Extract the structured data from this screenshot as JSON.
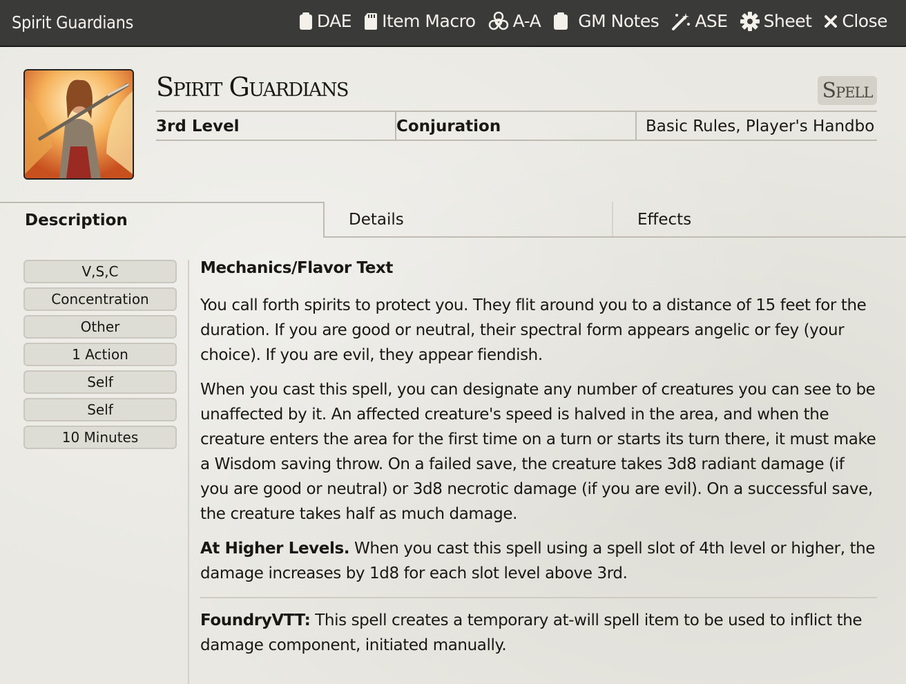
{
  "window": {
    "title": "Spirit Guardians",
    "actions": [
      {
        "label": "DAE",
        "icon": "clipboard-icon"
      },
      {
        "label": "Item Macro",
        "icon": "sd-card-icon"
      },
      {
        "label": "A-A",
        "icon": "biohazard-icon"
      },
      {
        "label": "GM Notes",
        "icon": "clipboard-icon"
      },
      {
        "label": "ASE",
        "icon": "magic-wand-icon"
      },
      {
        "label": "Sheet",
        "icon": "gear-icon"
      },
      {
        "label": "Close",
        "icon": "close-icon"
      }
    ]
  },
  "item": {
    "name": "Spirit Guardians",
    "type": "Spell",
    "level": "3rd Level",
    "school": "Conjuration",
    "source": "Basic Rules, Player's Handbo"
  },
  "tabs": {
    "description": "Description",
    "details": "Details",
    "effects": "Effects"
  },
  "properties": [
    "V,S,C",
    "Concentration",
    "Other",
    "1 Action",
    "Self",
    "Self",
    "10 Minutes"
  ],
  "description": {
    "heading": "Mechanics/Flavor Text",
    "p1": "You call forth spirits to protect you. They flit around you to a distance of 15 feet for the duration. If you are good or neutral, their spectral form appears angelic or fey (your choice). If you are evil, they appear fiendish.",
    "p2": "When you cast this spell, you can designate any number of creatures you can see to be unaffected by it. An affected creature's speed is halved in the area, and when the creature enters the area for the first time on a turn or starts its turn there, it must make a Wisdom saving throw. On a failed save, the creature takes 3d8 radiant damage (if you are good or neutral) or 3d8 necrotic damage (if you are evil). On a successful save, the creature takes half as much damage.",
    "higher_label": "At Higher Levels.",
    "higher_text": " When you cast this spell using a spell slot of 4th level or higher, the damage increases by 1d8 for each slot level above 3rd.",
    "foundry_label": "FoundryVTT:",
    "foundry_text": " This spell creates a temporary at-will spell item to be used to inflict the damage component, initiated manually."
  }
}
